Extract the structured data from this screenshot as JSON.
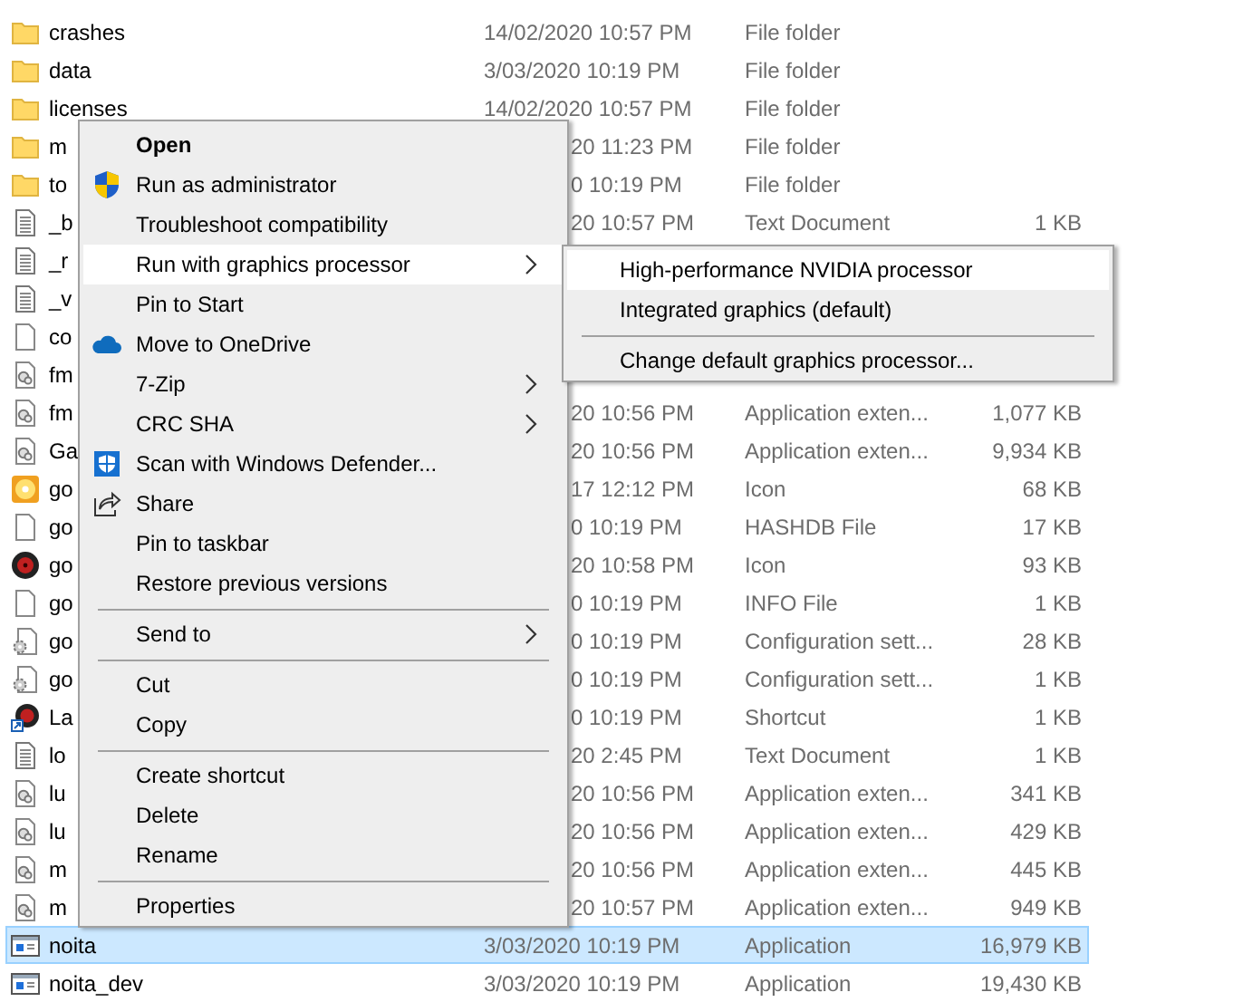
{
  "files": [
    {
      "name": "crashes",
      "kind": "folder",
      "date": "14/02/2020 10:57 PM",
      "type": "File folder",
      "selected": false
    },
    {
      "name": "data",
      "kind": "folder",
      "date": "3/03/2020 10:19 PM",
      "type": "File folder",
      "selected": false
    },
    {
      "name": "licenses",
      "kind": "folder",
      "date": "14/02/2020 10:57 PM",
      "type": "File folder",
      "selected": false
    },
    {
      "name": "m",
      "kind": "folder",
      "date": "20 11:23 PM",
      "type": "File folder",
      "selected": false
    },
    {
      "name": "to",
      "kind": "folder",
      "date": "0 10:19 PM",
      "type": "File folder",
      "selected": false
    },
    {
      "name": "_b",
      "kind": "text",
      "date": "20 10:57 PM",
      "type": "Text Document",
      "size": "1 KB",
      "selected": false
    },
    {
      "name": "_r",
      "kind": "text",
      "selected": false
    },
    {
      "name": "_v",
      "kind": "text",
      "selected": false
    },
    {
      "name": "co",
      "kind": "blank",
      "selected": false
    },
    {
      "name": "fm",
      "kind": "library",
      "selected": false
    },
    {
      "name": "fm",
      "kind": "library",
      "date": "20 10:56 PM",
      "type": "Application exten...",
      "size": "1,077 KB",
      "selected": false
    },
    {
      "name": "Ga",
      "kind": "library",
      "date": "20 10:56 PM",
      "type": "Application exten...",
      "size": "9,934 KB",
      "selected": false
    },
    {
      "name": "go",
      "kind": "disc",
      "date": "17 12:12 PM",
      "type": "Icon",
      "size": "68 KB",
      "selected": false
    },
    {
      "name": "go",
      "kind": "blank",
      "date": "0 10:19 PM",
      "type": "HASHDB File",
      "size": "17 KB",
      "selected": false
    },
    {
      "name": "go",
      "kind": "record",
      "date": "20 10:58 PM",
      "type": "Icon",
      "size": "93 KB",
      "selected": false
    },
    {
      "name": "go",
      "kind": "blank",
      "date": "0 10:19 PM",
      "type": "INFO File",
      "size": "1 KB",
      "selected": false
    },
    {
      "name": "go",
      "kind": "config",
      "date": "0 10:19 PM",
      "type": "Configuration sett...",
      "size": "28 KB",
      "selected": false
    },
    {
      "name": "go",
      "kind": "config",
      "date": "0 10:19 PM",
      "type": "Configuration sett...",
      "size": "1 KB",
      "selected": false
    },
    {
      "name": "La",
      "kind": "shortcut",
      "date": "0 10:19 PM",
      "type": "Shortcut",
      "size": "1 KB",
      "selected": false
    },
    {
      "name": "lo",
      "kind": "text",
      "date": "20 2:45 PM",
      "type": "Text Document",
      "size": "1 KB",
      "selected": false
    },
    {
      "name": "lu",
      "kind": "library",
      "date": "20 10:56 PM",
      "type": "Application exten...",
      "size": "341 KB",
      "selected": false
    },
    {
      "name": "lu",
      "kind": "library",
      "date": "20 10:56 PM",
      "type": "Application exten...",
      "size": "429 KB",
      "selected": false
    },
    {
      "name": "m",
      "kind": "library",
      "date": "20 10:56 PM",
      "type": "Application exten...",
      "size": "445 KB",
      "selected": false
    },
    {
      "name": "m",
      "kind": "library",
      "date": "20 10:57 PM",
      "type": "Application exten...",
      "size": "949 KB",
      "selected": false
    },
    {
      "name": "noita",
      "kind": "app",
      "date": "3/03/2020 10:19 PM",
      "type": "Application",
      "size": "16,979 KB",
      "selected": true
    },
    {
      "name": "noita_dev",
      "kind": "app",
      "date": "3/03/2020 10:19 PM",
      "type": "Application",
      "size": "19,430 KB",
      "selected": false
    }
  ],
  "context_menu": {
    "items": [
      {
        "kind": "item",
        "label": "Open",
        "default": true,
        "highlighted": false
      },
      {
        "kind": "item",
        "label": "Run as administrator",
        "default": false,
        "highlighted": false
      },
      {
        "kind": "item",
        "label": "Troubleshoot compatibility",
        "default": false,
        "highlighted": false
      },
      {
        "kind": "submenu",
        "label": "Run with graphics processor",
        "default": false,
        "highlighted": true
      },
      {
        "kind": "item",
        "label": "Pin to Start",
        "default": false,
        "highlighted": false
      },
      {
        "kind": "item",
        "label": "Move to OneDrive",
        "default": false,
        "highlighted": false
      },
      {
        "kind": "submenu",
        "label": "7-Zip",
        "default": false,
        "highlighted": false
      },
      {
        "kind": "submenu",
        "label": "CRC SHA",
        "default": false,
        "highlighted": false
      },
      {
        "kind": "item",
        "label": "Scan with Windows Defender...",
        "default": false,
        "highlighted": false
      },
      {
        "kind": "item",
        "label": "Share",
        "default": false,
        "highlighted": false
      },
      {
        "kind": "item",
        "label": "Pin to taskbar",
        "default": false,
        "highlighted": false
      },
      {
        "kind": "item",
        "label": "Restore previous versions",
        "default": false,
        "highlighted": false
      },
      {
        "kind": "separator"
      },
      {
        "kind": "submenu",
        "label": "Send to",
        "default": false,
        "highlighted": false
      },
      {
        "kind": "separator"
      },
      {
        "kind": "item",
        "label": "Cut",
        "default": false,
        "highlighted": false
      },
      {
        "kind": "item",
        "label": "Copy",
        "default": false,
        "highlighted": false
      },
      {
        "kind": "separator"
      },
      {
        "kind": "item",
        "label": "Create shortcut",
        "default": false,
        "highlighted": false
      },
      {
        "kind": "item",
        "label": "Delete",
        "default": false,
        "highlighted": false
      },
      {
        "kind": "item",
        "label": "Rename",
        "default": false,
        "highlighted": false
      },
      {
        "kind": "separator"
      },
      {
        "kind": "item",
        "label": "Properties",
        "default": false,
        "highlighted": false
      }
    ]
  },
  "submenu": {
    "items": [
      {
        "kind": "item",
        "label": "High-performance NVIDIA processor",
        "default": false,
        "highlighted": true
      },
      {
        "kind": "item",
        "label": "Integrated graphics (default)",
        "default": false,
        "highlighted": false
      },
      {
        "kind": "separator"
      },
      {
        "kind": "item",
        "label": "Change default graphics processor...",
        "default": false,
        "highlighted": false
      }
    ]
  }
}
